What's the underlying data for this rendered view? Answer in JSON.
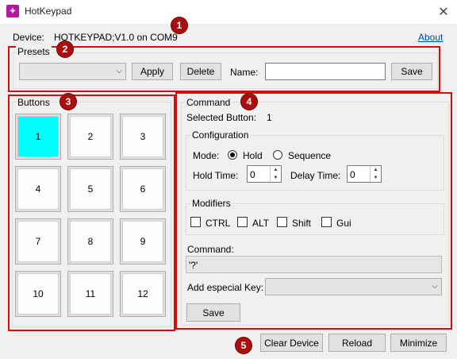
{
  "window": {
    "title": "HotKeypad",
    "app_icon": "hotkeypad-app-icon",
    "close_glyph": "✕"
  },
  "device": {
    "label": "Device:",
    "value": "HOTKEYPAD;V1.0 on COM9",
    "about_link": "About"
  },
  "markers": [
    "1",
    "2",
    "3",
    "4",
    "5"
  ],
  "presets": {
    "title": "Presets",
    "selected": "",
    "apply_label": "Apply",
    "delete_label": "Delete",
    "name_label": "Name:",
    "name_value": "",
    "save_label": "Save"
  },
  "buttons": {
    "title": "Buttons",
    "keys": [
      "1",
      "2",
      "3",
      "4",
      "5",
      "6",
      "7",
      "8",
      "9",
      "10",
      "11",
      "12"
    ],
    "selected_key": "1",
    "selected_color": "#00ffff"
  },
  "command": {
    "title": "Command",
    "selected_button_label": "Selected Button:",
    "selected_button_value": "1",
    "configuration": {
      "title": "Configuration",
      "mode_label": "Mode:",
      "mode_options": [
        "Hold",
        "Sequence"
      ],
      "mode_selected": "Hold",
      "hold_time_label": "Hold Time:",
      "hold_time_value": "0",
      "delay_time_label": "Delay Time:",
      "delay_time_value": "0"
    },
    "modifiers": {
      "title": "Modifiers",
      "items": [
        "CTRL",
        "ALT",
        "Shift",
        "Gui"
      ],
      "checked": []
    },
    "command_label": "Command:",
    "command_value": "'?'",
    "special_key_label": "Add especial Key:",
    "special_key_value": "",
    "save_label": "Save"
  },
  "footer": {
    "clear_device_label": "Clear Device",
    "reload_label": "Reload",
    "minimize_label": "Minimize"
  },
  "colors": {
    "annotation_red": "#d01010",
    "marker_fill": "#a80f0f",
    "selected_key": "#00ffff",
    "link": "#0645ad"
  }
}
